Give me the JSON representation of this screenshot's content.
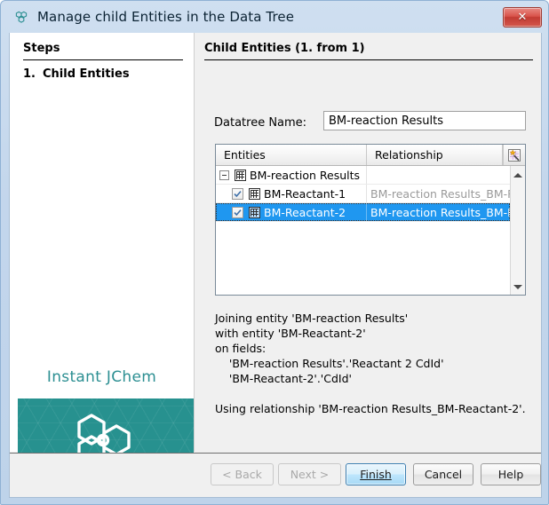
{
  "window": {
    "title": "Manage child Entities in the Data Tree",
    "icon": "jchem-molecule-icon",
    "close_label": "✕"
  },
  "steps": {
    "heading": "Steps",
    "items": [
      {
        "number": "1.",
        "label": "Child Entities"
      }
    ]
  },
  "branding": {
    "product": "Instant JChem",
    "logo": "hexagon-molecule-logo"
  },
  "content": {
    "heading": "Child Entities (1. from 1)",
    "datatree_label": "Datatree Name:",
    "datatree_value": "BM-reaction Results",
    "datatree_placeholder": "Datatree Name"
  },
  "table": {
    "columns": [
      "Entities",
      "Relationship"
    ],
    "corner_button": "column-chooser-icon",
    "rows": [
      {
        "entity": "BM-reaction Results",
        "relationship": "",
        "level": 0,
        "expander": "collapse-toggle",
        "checkbox": null,
        "selected": false
      },
      {
        "entity": "BM-Reactant-1",
        "relationship": "BM-reaction Results_BM-R...",
        "level": 1,
        "expander": null,
        "checkbox": "checked",
        "selected": false
      },
      {
        "entity": "BM-Reactant-2",
        "relationship": "BM-reaction Results_BM-R...",
        "level": 1,
        "expander": null,
        "checkbox": "checked",
        "selected": true
      }
    ],
    "scrollbar": {
      "up": "scroll-up-arrow",
      "down": "scroll-down-arrow"
    }
  },
  "description": "Joining entity 'BM-reaction Results'\nwith entity 'BM-Reactant-2'\non fields:\n    'BM-reaction Results'.'Reactant 2 CdId'\n    'BM-Reactant-2'.'CdId'\n\nUsing relationship 'BM-reaction Results_BM-Reactant-2'.",
  "buttons": {
    "back": {
      "label": "< Back",
      "mnemonic": "B",
      "enabled": false,
      "default": false
    },
    "next": {
      "label": "Next >",
      "mnemonic": "N",
      "enabled": false,
      "default": false
    },
    "finish": {
      "label": "Finish",
      "mnemonic": "F",
      "enabled": true,
      "default": true
    },
    "cancel": {
      "label": "Cancel",
      "mnemonic": "",
      "enabled": true,
      "default": false
    },
    "help": {
      "label": "Help",
      "mnemonic": "H",
      "enabled": true,
      "default": false
    }
  },
  "colors": {
    "brand_teal": "#27918f",
    "brand_text": "#2c8f92",
    "selection_blue": "#1f97f0",
    "titlebar_blue": "#cfdff0"
  }
}
